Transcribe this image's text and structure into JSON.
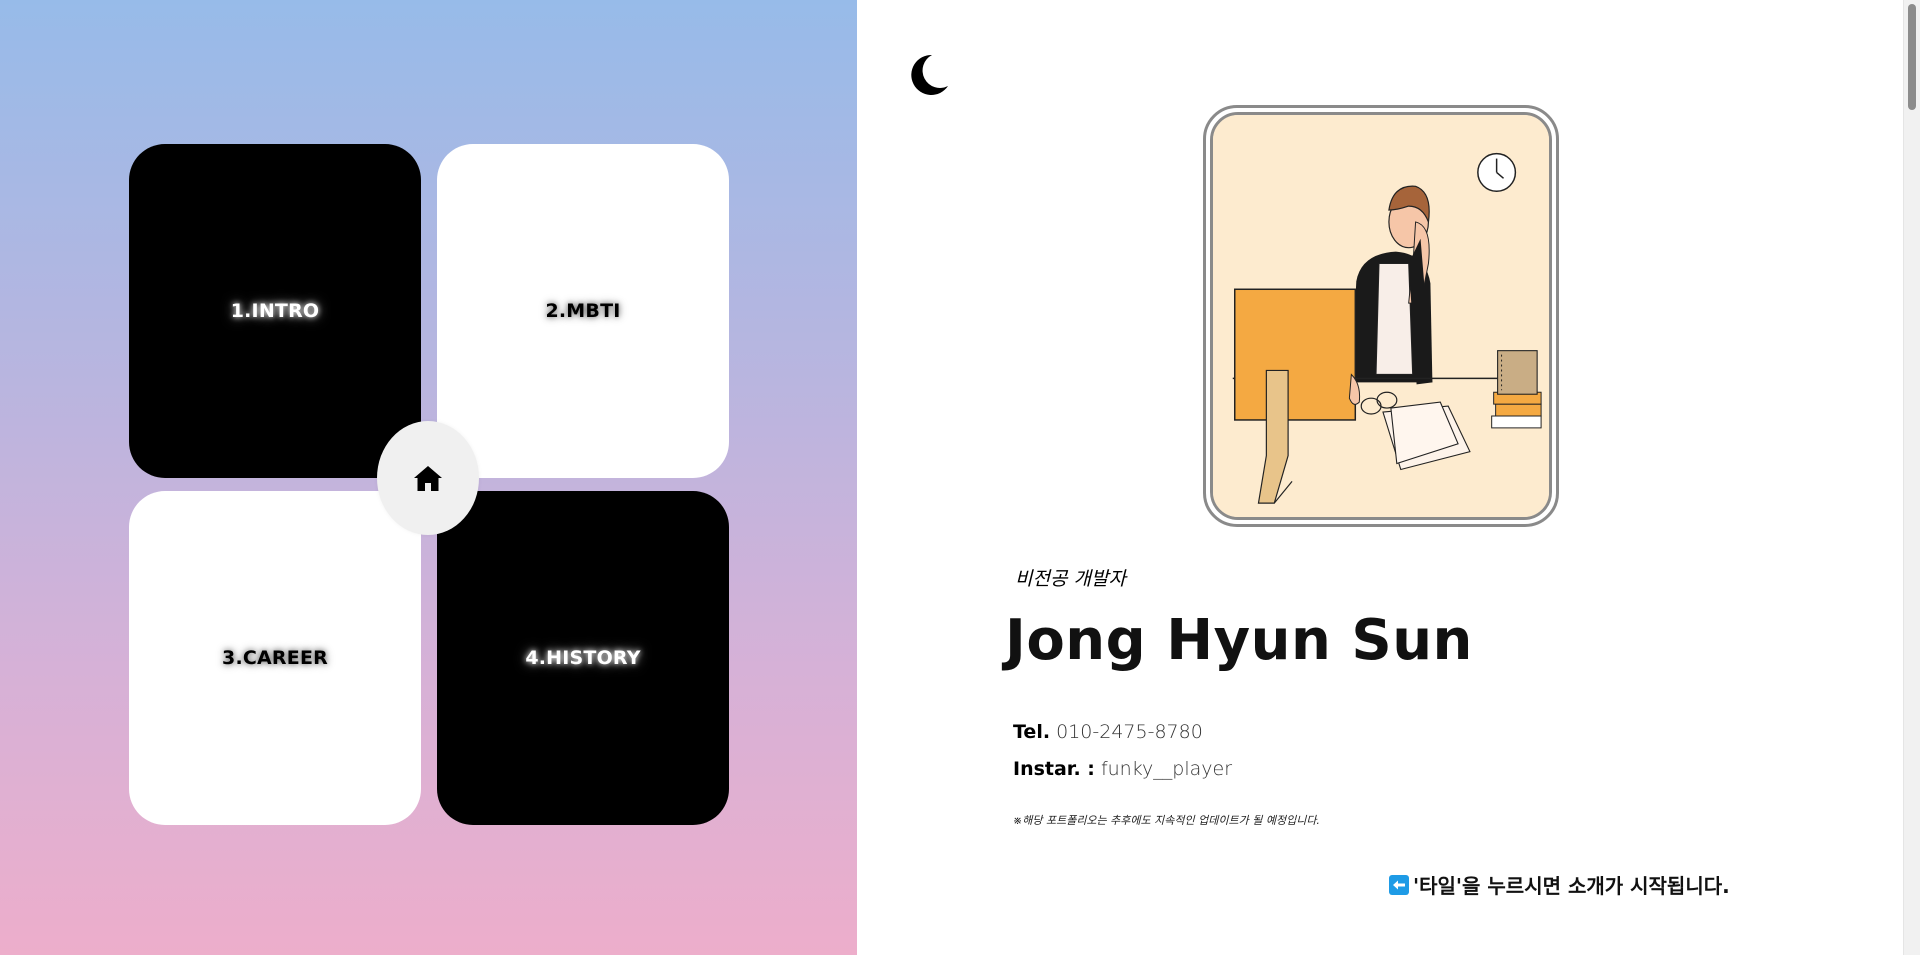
{
  "tiles": [
    {
      "label": "1.INTRO",
      "theme": "dark"
    },
    {
      "label": "2.MBTI",
      "theme": "light"
    },
    {
      "label": "3.CAREER",
      "theme": "light"
    },
    {
      "label": "4.HISTORY",
      "theme": "dark"
    }
  ],
  "home_button": {
    "icon": "home-icon"
  },
  "theme_toggle": {
    "icon": "moon-icon"
  },
  "profile": {
    "subtitle": "비전공 개발자",
    "name": "Jong Hyun Sun",
    "tel_label": "Tel.",
    "tel_value": "010-2475-8780",
    "insta_label": "Instar. :",
    "insta_value": "funky__player",
    "notice": "※해당 포트폴리오는 추후에도 지속적인 업데이트가 될 예정입니다.",
    "hint": "'타일'을 누르시면 소개가 시작됩니다.",
    "hint_icon": "left-arrow-icon"
  },
  "colors": {
    "gradient_top": "#97bbe9",
    "gradient_bottom": "#edaecb",
    "tile_dark": "#000000",
    "tile_light": "#ffffff",
    "hint_icon_bg": "#1e9be6",
    "photo_bg": "#fdebcf"
  }
}
